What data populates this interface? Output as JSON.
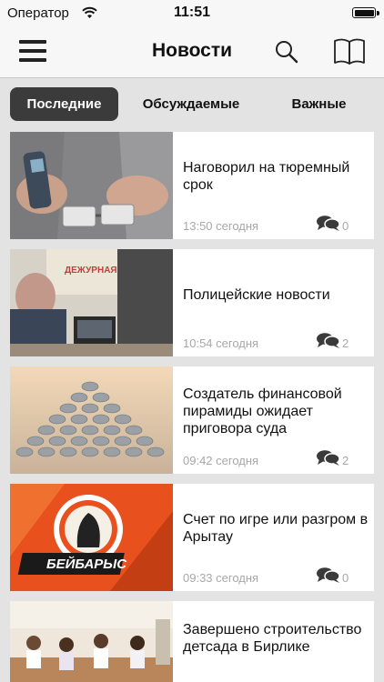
{
  "status": {
    "carrier": "Оператор",
    "time": "11:51"
  },
  "nav": {
    "title": "Новости",
    "icons": [
      "menu-icon",
      "search-icon",
      "book-icon"
    ]
  },
  "tabs": [
    {
      "label": "Последние",
      "active": true
    },
    {
      "label": "Обсуждаемые",
      "active": false
    },
    {
      "label": "Важные",
      "active": false
    }
  ],
  "articles": [
    {
      "title": "Наговорил на тюремный срок",
      "time": "13:50 сегодня",
      "comments": "0"
    },
    {
      "title": "Полицейские новости",
      "time": "10:54 сегодня",
      "comments": "2"
    },
    {
      "title": "Создатель финансовой пирамиды ожидает приговора суда",
      "time": "09:42 сегодня",
      "comments": "2"
    },
    {
      "title": "Счет по игре или разгром в Арытау",
      "time": "09:33 сегодня",
      "comments": "0"
    },
    {
      "title": "Завершено строительство детсада в Бирлике",
      "time": "",
      "comments": ""
    }
  ],
  "thumbnail_text": {
    "logo": "БЕЙБАРЫС",
    "sign": "ДЕЖУРНАЯ ЧАСТЬ"
  },
  "colors": {
    "accent_dark": "#3b3b3b",
    "meta_gray": "#a8a8a8",
    "background": "#e3e3e3"
  }
}
